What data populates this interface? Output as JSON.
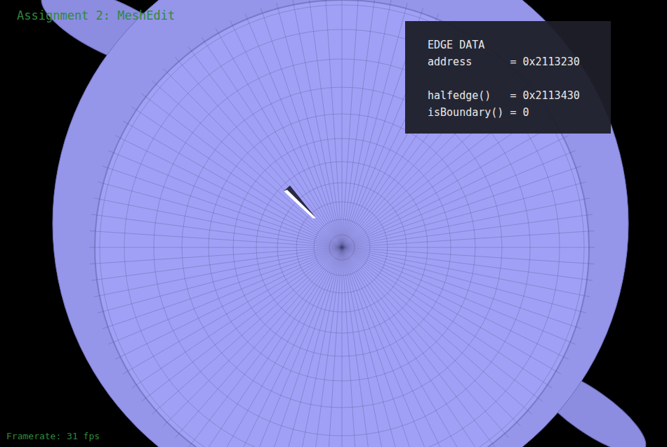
{
  "window": {
    "title": "Assignment 2: MeshEdit"
  },
  "info_panel": {
    "title": "EDGE DATA",
    "groups": [
      [
        "address      = 0x2113230"
      ],
      [
        "halfedge()   = 0x2113430",
        "isBoundary() = 0"
      ]
    ]
  },
  "status_bar": {
    "framerate": "Framerate: 31 fps"
  }
}
